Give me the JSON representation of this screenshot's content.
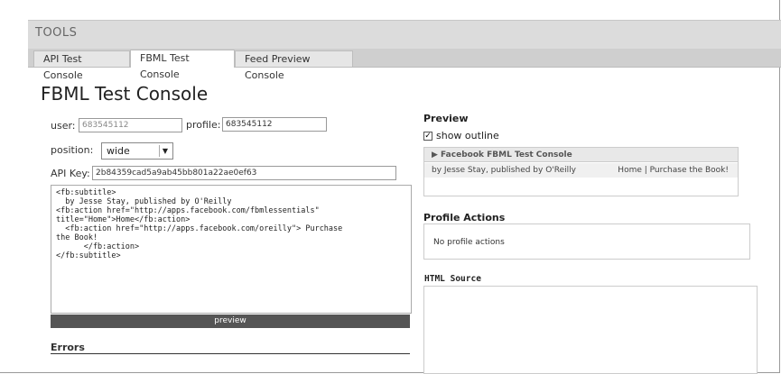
{
  "tools": {
    "title": "TOOLS"
  },
  "tabs": [
    {
      "label": "API Test Console"
    },
    {
      "label": "FBML Test Console"
    },
    {
      "label": "Feed Preview Console"
    }
  ],
  "page": {
    "title": "FBML Test Console"
  },
  "form": {
    "user_label": "user:",
    "user_value": "683545112",
    "profile_label": "profile:",
    "profile_value": "683545112",
    "position_label": "position:",
    "position_value": "wide",
    "apikey_label": "API Key:",
    "apikey_value": "2b84359cad5a9ab45bb801a22ae0ef63",
    "code": "<fb:subtitle>\n  by Jesse Stay, published by O'Reilly\n<fb:action href=\"http://apps.facebook.com/fbmlessentials\"\ntitle=\"Home\">Home</fb:action>\n  <fb:action href=\"http://apps.facebook.com/oreilly\"> Purchase\nthe Book!\n      </fb:action>\n</fb:subtitle>",
    "preview_button": "preview",
    "errors_title": "Errors"
  },
  "preview": {
    "title": "Preview",
    "show_outline_label": "show outline",
    "show_outline_checked": true,
    "header": "▶  Facebook FBML Test Console",
    "by_text": "by Jesse Stay, published by O'Reilly",
    "links_text": "Home |  Purchase the Book!"
  },
  "profile_actions": {
    "title": "Profile Actions",
    "empty_text": "No profile actions"
  },
  "html_source": {
    "title": "HTML Source"
  }
}
